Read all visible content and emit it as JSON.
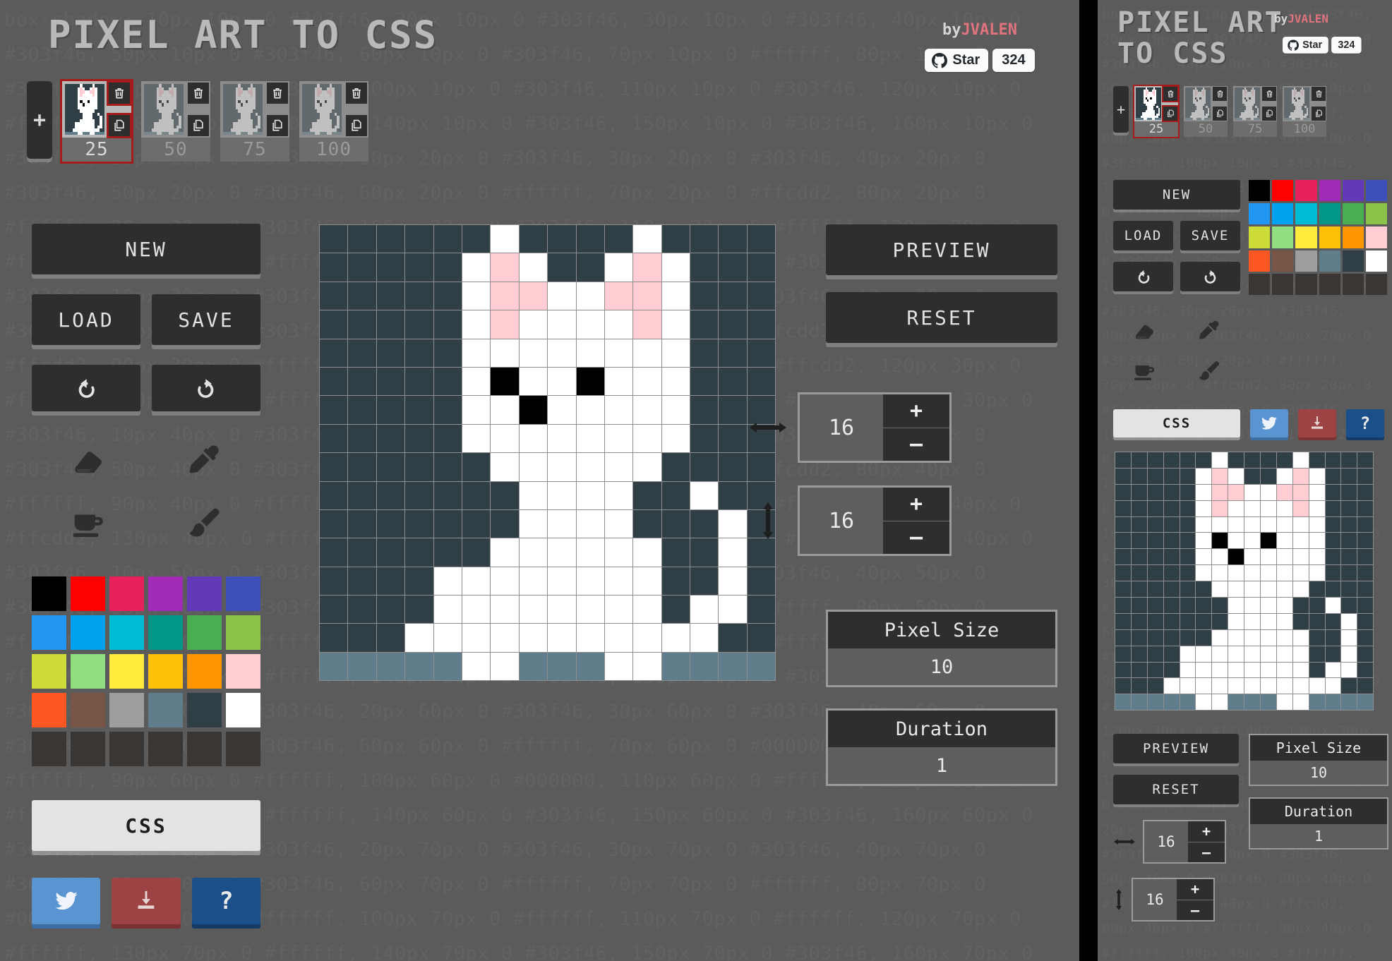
{
  "app": {
    "title": "PIXEL ART TO CSS",
    "title_line1": "PIXEL ART",
    "title_line2": "TO CSS",
    "byline_prefix": "by",
    "byline_author": "JVALEN"
  },
  "github": {
    "star_label": "Star",
    "count": "324",
    "icon": "github-icon"
  },
  "frames": {
    "add_label": "+",
    "items": [
      {
        "label": "25",
        "selected": true
      },
      {
        "label": "50",
        "selected": false
      },
      {
        "label": "75",
        "selected": false
      },
      {
        "label": "100",
        "selected": false
      }
    ],
    "delete_icon": "trash-icon",
    "copy_icon": "copy-icon"
  },
  "actions": {
    "new": "NEW",
    "load": "LOAD",
    "save": "SAVE",
    "undo_icon": "undo-icon",
    "redo_icon": "redo-icon",
    "preview": "PREVIEW",
    "reset": "RESET",
    "css": "CSS"
  },
  "tools": [
    {
      "name": "eraser-tool",
      "icon": "eraser-icon"
    },
    {
      "name": "eyedropper-tool",
      "icon": "eyedropper-icon"
    },
    {
      "name": "bucket-tool",
      "icon": "bucket-icon"
    },
    {
      "name": "brush-tool",
      "icon": "paintbrush-icon"
    }
  ],
  "social": [
    {
      "name": "twitter-share",
      "icon": "twitter-icon",
      "color": "#5b95d1"
    },
    {
      "name": "download",
      "icon": "download-icon",
      "color": "#9e4344"
    },
    {
      "name": "help",
      "icon": "question-icon",
      "label": "?",
      "color": "#1b4f8a"
    }
  ],
  "palette": [
    [
      "#000000",
      "#fd0002",
      "#e8205c",
      "#a12bb6",
      "#6339ba",
      "#3e4eba"
    ],
    [
      "#2196f3",
      "#00a2f0",
      "#00bcd4",
      "#029688",
      "#4aaf50",
      "#8bc34a"
    ],
    [
      "#cddc39",
      "#91de81",
      "#ffeb3b",
      "#ffc107",
      "#ff9800",
      "#ffcdd2"
    ],
    [
      "#ff5722",
      "#795548",
      "#9e9e9e",
      "#607d8b",
      "#303f46",
      "#ffffff"
    ],
    [
      "#3a3633",
      "#3a3633",
      "#3a3633",
      "#3a3633",
      "#3a3633",
      "#3a3633"
    ]
  ],
  "dimensions": {
    "width_label": "width-arrow",
    "width_value": "16",
    "height_label": "height-arrow",
    "height_value": "16",
    "plus": "+",
    "minus": "–"
  },
  "settings": {
    "pixel_size_label": "Pixel Size",
    "pixel_size_value": "10",
    "duration_label": "Duration",
    "duration_value": "1"
  },
  "canvas": {
    "columns": 16,
    "rows": 16,
    "colors": {
      "bg": "#303f46",
      "white": "#ffffff",
      "pink": "#ffcdd2",
      "black": "#000000",
      "blue": "#607d8b"
    },
    "legend": {
      "d": "#303f46",
      "w": "#ffffff",
      "p": "#ffcdd2",
      "k": "#000000",
      "b": "#607d8b"
    },
    "pixels": [
      "dddddd w dddd w dddd",
      "ddddd wpw dd wpw ddd",
      "ddddd wpp ww pp w dd",
      "ddddd wp wwww p w dd",
      "ddddd wwwwwwww  ddd",
      "ddddd wkww k www ddd",
      "ddddd ww k wwww  ddd",
      "ddddd wwwwwwww  dddd",
      "dddddd wwwwww ddddd",
      "ddddddd wwww dd w dd",
      "ddddddd wwww ddd w d",
      "dddddd wwwwww dd w d",
      "dddd wwwwwwww dd w d",
      "dddd wwwwwwww d ww d",
      "ddd wwwwwwwwww dd",
      "bbbbb ww bbb ww bbbb"
    ],
    "rows_data": [
      [
        "d",
        "d",
        "d",
        "d",
        "d",
        "d",
        "w",
        "d",
        "d",
        "d",
        "d",
        "w",
        "d",
        "d",
        "d",
        "d"
      ],
      [
        "d",
        "d",
        "d",
        "d",
        "d",
        "w",
        "p",
        "w",
        "d",
        "d",
        "w",
        "p",
        "w",
        "d",
        "d",
        "d"
      ],
      [
        "d",
        "d",
        "d",
        "d",
        "d",
        "w",
        "p",
        "p",
        "w",
        "w",
        "p",
        "p",
        "w",
        "d",
        "d",
        "d"
      ],
      [
        "d",
        "d",
        "d",
        "d",
        "d",
        "w",
        "p",
        "w",
        "w",
        "w",
        "w",
        "p",
        "w",
        "d",
        "d",
        "d"
      ],
      [
        "d",
        "d",
        "d",
        "d",
        "d",
        "w",
        "w",
        "w",
        "w",
        "w",
        "w",
        "w",
        "w",
        "d",
        "d",
        "d"
      ],
      [
        "d",
        "d",
        "d",
        "d",
        "d",
        "w",
        "k",
        "w",
        "w",
        "k",
        "w",
        "w",
        "w",
        "d",
        "d",
        "d"
      ],
      [
        "d",
        "d",
        "d",
        "d",
        "d",
        "w",
        "w",
        "k",
        "w",
        "w",
        "w",
        "w",
        "w",
        "d",
        "d",
        "d"
      ],
      [
        "d",
        "d",
        "d",
        "d",
        "d",
        "w",
        "w",
        "w",
        "w",
        "w",
        "w",
        "w",
        "w",
        "d",
        "d",
        "d"
      ],
      [
        "d",
        "d",
        "d",
        "d",
        "d",
        "d",
        "w",
        "w",
        "w",
        "w",
        "w",
        "w",
        "d",
        "d",
        "d",
        "d"
      ],
      [
        "d",
        "d",
        "d",
        "d",
        "d",
        "d",
        "d",
        "w",
        "w",
        "w",
        "w",
        "d",
        "d",
        "w",
        "d",
        "d"
      ],
      [
        "d",
        "d",
        "d",
        "d",
        "d",
        "d",
        "d",
        "w",
        "w",
        "w",
        "w",
        "d",
        "d",
        "d",
        "w",
        "d"
      ],
      [
        "d",
        "d",
        "d",
        "d",
        "d",
        "d",
        "w",
        "w",
        "w",
        "w",
        "w",
        "w",
        "d",
        "d",
        "w",
        "d"
      ],
      [
        "d",
        "d",
        "d",
        "d",
        "w",
        "w",
        "w",
        "w",
        "w",
        "w",
        "w",
        "w",
        "d",
        "d",
        "w",
        "d"
      ],
      [
        "d",
        "d",
        "d",
        "d",
        "w",
        "w",
        "w",
        "w",
        "w",
        "w",
        "w",
        "w",
        "d",
        "w",
        "w",
        "d"
      ],
      [
        "d",
        "d",
        "d",
        "w",
        "w",
        "w",
        "w",
        "w",
        "w",
        "w",
        "w",
        "w",
        "w",
        "w",
        "d",
        "d"
      ],
      [
        "b",
        "b",
        "b",
        "b",
        "b",
        "w",
        "w",
        "b",
        "b",
        "b",
        "w",
        "w",
        "b",
        "b",
        "b",
        "b"
      ]
    ]
  },
  "background_code": "box-shadow: 10px 10px 0 #303f46, 20px 10px 0 #303f46, 30px 10px 0 #303f46, 40px 10px 0 #303f46, 50px 10px 0 #303f46, 60px 10px 0 #303f46, 70px 10px 0 #ffffff, 80px 10px 0 #303f46, 90px 10px 0 #303f46, 100px 10px 0 #303f46, 110px 10px 0 #303f46, 120px 10px 0 #ffffff, 130px 10px 0 #303f46, 140px 10px 0 #303f46, 150px 10px 0 #303f46, 160px 10px 0 #303f46, 10px 20px 0 #303f46, 20px 20px 0 #303f46, 30px 20px 0 #303f46, 40px 20px 0 #303f46, 50px 20px 0 #303f46, 60px 20px 0 #ffffff, 70px 20px 0 #ffcdd2, 80px 20px 0 #ffffff, 90px 20px 0 #303f46, 100px 20px 0 #303f46, 110px 20px 0 #ffffff, 120px 20px 0 #ffcdd2, 130px 20px 0 #ffffff, 140px 20px 0 #303f46, 150px 20px 0 #303f46, 160px 20px 0 #303f46, 10px 30px 0 #303f46, 20px 30px 0 #303f46, 30px 30px 0 #303f46, 40px 30px 0 #303f46, 50px 30px 0 #303f46, 60px 30px 0 #ffffff, 70px 30px 0 #ffcdd2, 80px 30px 0 #ffcdd2, 90px 30px 0 #ffffff, 100px 30px 0 #ffffff, 110px 30px 0 #ffcdd2, 120px 30px 0 #ffcdd2, 130px 30px 0 #ffffff, 140px 30px 0 #303f46, 150px 30px 0 #303f46, 160px 30px 0 #303f46, 10px 40px 0 #303f46, 20px 40px 0 #303f46, 30px 40px 0 #303f46, 40px 40px 0 #303f46, 50px 40px 0 #303f46, 60px 40px 0 #ffffff, 70px 40px 0 #ffcdd2, 80px 40px 0 #ffffff, 90px 40px 0 #ffffff, 100px 40px 0 #ffffff, 110px 40px 0 #ffffff, 120px 40px 0 #ffcdd2, 130px 40px 0 #ffffff, 140px 40px 0 #303f46, 150px 40px 0 #303f46, 160px 40px 0 #303f46, 10px 50px 0 #303f46, 20px 50px 0 #303f46, 30px 50px 0 #303f46, 40px 50px 0 #303f46, 50px 50px 0 #303f46, 60px 50px 0 #ffffff, 70px 50px 0 #ffffff, 80px 50px 0 #ffffff, 90px 50px 0 #ffffff, 100px 50px 0 #ffffff, 110px 50px 0 #ffffff, 120px 50px 0 #ffffff, 130px 50px 0 #ffffff, 140px 50px 0 #303f46, 150px 50px 0 #303f46, 160px 50px 0 #303f46, 10px 60px 0 #303f46, 20px 60px 0 #303f46, 30px 60px 0 #303f46, 40px 60px 0 #303f46, 50px 60px 0 #303f46, 60px 60px 0 #ffffff, 70px 60px 0 #000000, 80px 60px 0 #ffffff, 90px 60px 0 #ffffff, 100px 60px 0 #000000, 110px 60px 0 #ffffff, 120px 60px 0 #ffffff, 130px 60px 0 #ffffff, 140px 60px 0 #303f46, 150px 60px 0 #303f46, 160px 60px 0 #303f46, 10px 70px 0 #303f46, 20px 70px 0 #303f46, 30px 70px 0 #303f46, 40px 70px 0 #303f46, 50px 70px 0 #303f46, 60px 70px 0 #ffffff, 70px 70px 0 #ffffff, 80px 70px 0 #000000, 90px 70px 0 #ffffff, 100px 70px 0 #ffffff, 110px 70px 0 #ffffff, 120px 70px 0 #ffffff, 130px 70px 0 #ffffff, 140px 70px 0 #303f46, 150px 70px 0 #303f46, 160px 70px 0 #303f46, 10px 80px 0 #303f46, 20px 80px 0 #303f46, 30px 80px 0 #303f46, 40px 80px 0 #303f46, 50px 80px 0 #303f46, 60px 80px 0 #ffffff, 70px 80px 0 #ffffff, 80px 80px 0 #ffffff, 90px 80px 0 #ffffff, 100px 80px 0 #ffffff, 110px 80px 0 #ffffff, 120px 80px 0 #ffffff, 130px 80px 0 #ffffff, 140px 80px 0 #303f46, 150px 80px 0 #303f46, 160px 80px 0 #303f46, 10px 90px 0 #303f46, 20px 90px 0 #303f46, 30px 90px 0 #303f46, 40px 90px 0 #303f46"
}
